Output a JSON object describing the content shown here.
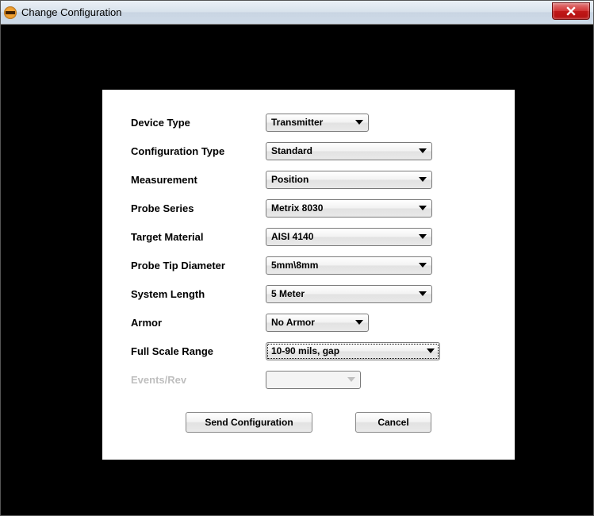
{
  "window": {
    "title": "Change Configuration"
  },
  "labels": {
    "device_type": "Device Type",
    "configuration_type": "Configuration Type",
    "measurement": "Measurement",
    "probe_series": "Probe Series",
    "target_material": "Target Material",
    "probe_tip_diameter": "Probe Tip Diameter",
    "system_length": "System Length",
    "armor": "Armor",
    "full_scale_range": "Full Scale Range",
    "events_rev": "Events/Rev"
  },
  "values": {
    "device_type": "Transmitter",
    "configuration_type": "Standard",
    "measurement": "Position",
    "probe_series": "Metrix 8030",
    "target_material": "AISI 4140",
    "probe_tip_diameter": "5mm\\8mm",
    "system_length": "5 Meter",
    "armor": "No Armor",
    "full_scale_range": "10-90 mils, gap",
    "events_rev": ""
  },
  "buttons": {
    "send": "Send Configuration",
    "cancel": "Cancel"
  }
}
